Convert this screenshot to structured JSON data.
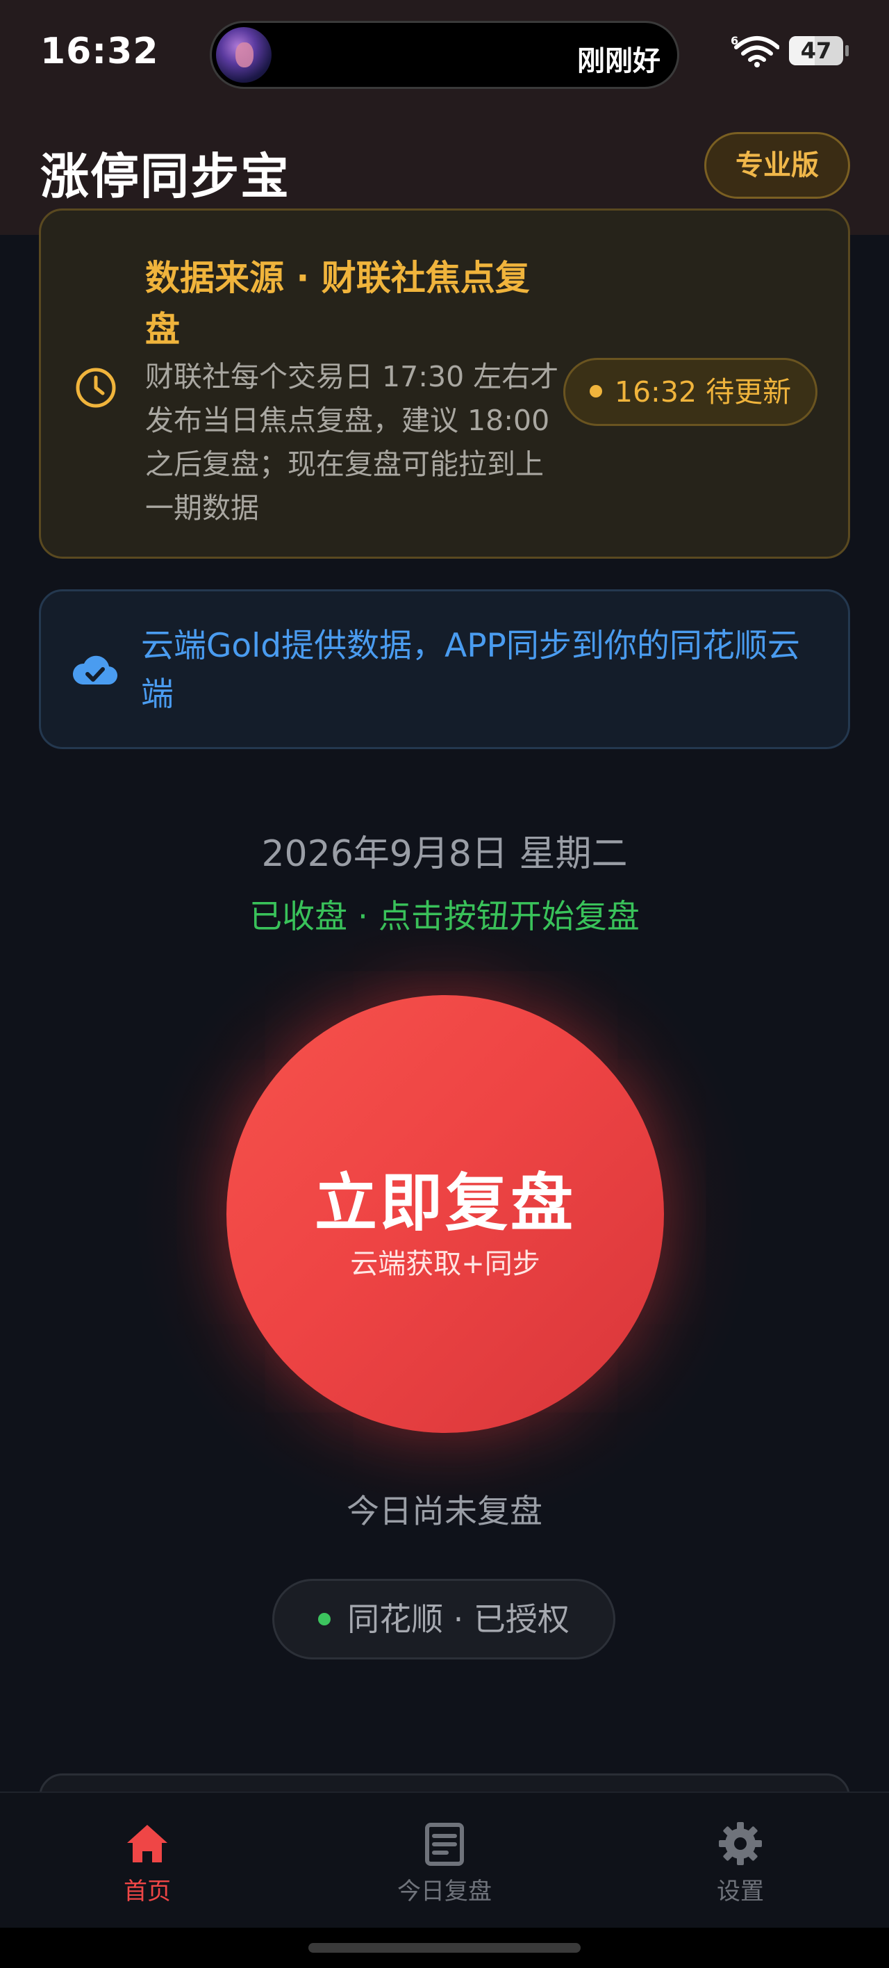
{
  "status_bar": {
    "time": "16:32",
    "island_text": "刚刚好",
    "battery": "47",
    "battery_level_percent": 47
  },
  "header": {
    "title": "涨停同步宝",
    "pro_badge": "专业版"
  },
  "notice": {
    "title": "数据来源 · 财联社焦点复盘",
    "body": "财联社每个交易日 17:30 左右才发布当日焦点复盘，建议 18:00 之后复盘；现在复盘可能拉到上一期数据",
    "pending_label": "16:32 待更新",
    "icon": "clock-icon",
    "accent_color": "#f0b43c"
  },
  "cloud_info": {
    "text": "云端Gold提供数据，APP同步到你的同花顺云端",
    "icon": "cloud-check-icon",
    "accent_color": "#4a9cf0"
  },
  "main": {
    "date": "2026年9月8日 星期二",
    "market_status": "已收盘 · 点击按钮开始复盘",
    "button_label": "立即复盘",
    "button_sub": "云端获取+同步",
    "today_status": "今日尚未复盘",
    "auth_status": "同花顺 · 已授权",
    "button_color": "#ee4444",
    "status_color": "#39c25a"
  },
  "nav": {
    "items": [
      {
        "label": "首页",
        "icon": "home-icon",
        "active": true
      },
      {
        "label": "今日复盘",
        "icon": "document-icon",
        "active": false
      },
      {
        "label": "设置",
        "icon": "gear-icon",
        "active": false
      }
    ],
    "active_color": "#ef4646"
  }
}
